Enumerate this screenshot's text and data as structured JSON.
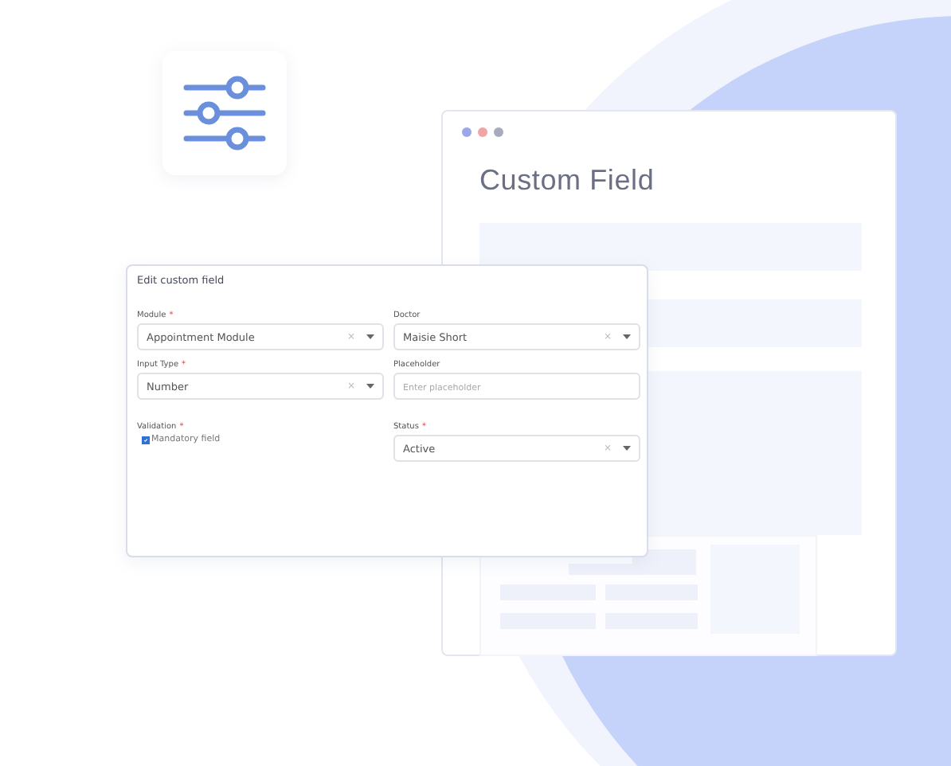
{
  "back_window": {
    "title": "Custom Field",
    "dots": [
      {
        "color": "#9aa8e8"
      },
      {
        "color": "#f0a4a4"
      },
      {
        "color": "#a9abbd"
      }
    ]
  },
  "form": {
    "title": "Edit custom field",
    "fields": [
      {
        "kind": "select",
        "label": "Module",
        "required_mark": "*",
        "value": "Appointment Module",
        "clear": "×"
      },
      {
        "kind": "select",
        "label": "Doctor",
        "value": "Maisie Short",
        "clear": "×"
      },
      {
        "kind": "select",
        "label": "Input Type",
        "required_mark": "*",
        "value": "Number",
        "clear": "×"
      },
      {
        "kind": "text",
        "label": "Placeholder",
        "placeholder": "Enter placeholder"
      },
      {
        "kind": "checkbox",
        "label": "Validation",
        "required_mark": "*",
        "option": "Mandatory field",
        "checked": true
      },
      {
        "kind": "select",
        "label": "Status",
        "required_mark": "*",
        "value": "Active",
        "clear": "×"
      }
    ]
  }
}
